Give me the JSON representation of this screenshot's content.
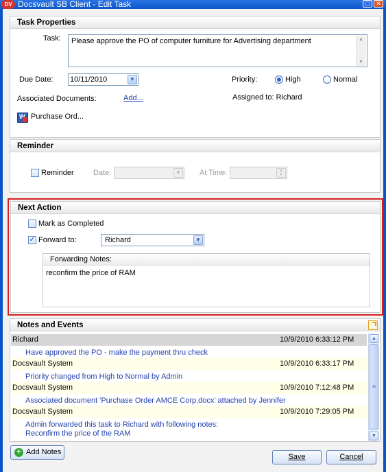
{
  "window": {
    "icon": "DV",
    "title": "Docsvault SB Client - Edit Task",
    "maximize_glyph": "□",
    "close_glyph": "✕"
  },
  "task_properties": {
    "header": "Task Properties",
    "task_label": "Task:",
    "task_value": "Please approve the PO of computer furniture for Advertising department",
    "due_date_label": "Due Date:",
    "due_date_value": "10/11/2010",
    "priority_label": "Priority:",
    "priority_high": "High",
    "priority_normal": "Normal",
    "priority_selected": "High",
    "assoc_docs_label": "Associated Documents:",
    "add_link": "Add...",
    "assigned_to": "Assigned to: Richard",
    "document_name": "Purchase Ord..."
  },
  "reminder": {
    "header": "Reminder",
    "checkbox_label": "Reminder",
    "checked": false,
    "date_label": "Date:",
    "time_label": "At Time:"
  },
  "next_action": {
    "header": "Next Action",
    "mark_completed_label": "Mark as Completed",
    "mark_completed_checked": false,
    "forward_label": "Forward to:",
    "forward_checked": true,
    "forward_value": "Richard",
    "forwarding_notes_label": "Forwarding Notes:",
    "forwarding_notes_value": "reconfirm the price of RAM",
    "highlight_color": "#d42020"
  },
  "notes_events": {
    "header": "Notes and Events",
    "entries": [
      {
        "who": "Richard",
        "when": "10/9/2010 6:33:12 PM",
        "message": "Have approved the PO - make the payment thru check"
      },
      {
        "who": "Docsvault System",
        "when": "10/9/2010 6:33:17 PM",
        "message": "Priority changed from High to Normal by Admin"
      },
      {
        "who": "Docsvault System",
        "when": "10/9/2010 7:12:48 PM",
        "message": "Associated document 'Purchase Order AMCE Corp.docx' attached by Jennifer"
      },
      {
        "who": "Docsvault System",
        "when": "10/9/2010 7:29:05 PM",
        "message": "Admin forwarded this task to Richard with following notes:",
        "message2": "Reconfirm the price of the RAM"
      }
    ]
  },
  "footer": {
    "add_notes": "Add Notes",
    "save": "Save",
    "cancel": "Cancel"
  }
}
